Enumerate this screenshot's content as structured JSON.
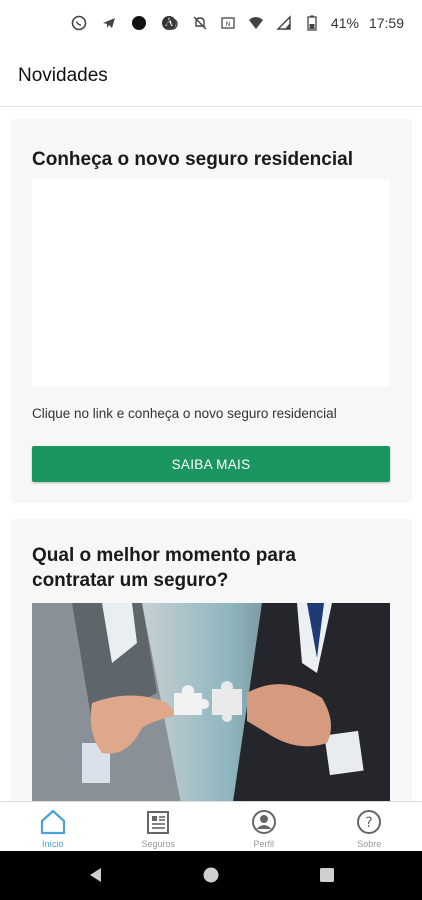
{
  "status_bar": {
    "battery_text": "41%",
    "time": "17:59",
    "left_icons": [
      "whatsapp-icon",
      "telegram-icon",
      "dot-icon",
      "app-icon"
    ],
    "right_icons": [
      "alarm-icon",
      "mute-icon",
      "nfc-icon",
      "wifi-icon",
      "signal-icon",
      "battery-icon"
    ]
  },
  "app_bar": {
    "title": "Novidades"
  },
  "cards": [
    {
      "title": "Conheça o novo seguro residencial",
      "description": "Clique no link e conheça o novo seguro residencial",
      "button_label": "SAIBA MAIS"
    },
    {
      "title": "Qual o melhor momento para contratar um seguro?"
    }
  ],
  "bottom_nav": {
    "items": [
      {
        "label": "Início",
        "icon": "home-icon",
        "active": true
      },
      {
        "label": "Seguros",
        "icon": "newspaper-icon",
        "active": false
      },
      {
        "label": "Perfil",
        "icon": "profile-icon",
        "active": false
      },
      {
        "label": "Sobre",
        "icon": "help-icon",
        "active": false
      }
    ]
  },
  "colors": {
    "primary_button": "#1b9660",
    "active_nav": "#4aa3d6",
    "inactive_nav": "#9a9a9a"
  }
}
